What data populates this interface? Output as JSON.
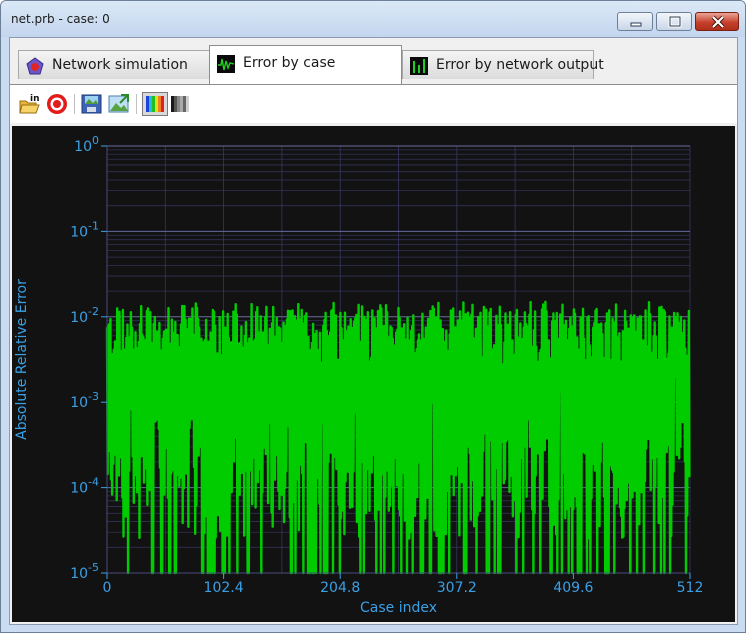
{
  "window": {
    "title": "net.prb - case: 0"
  },
  "tabs": [
    {
      "label": "Network simulation",
      "icon": "network-simulation-icon",
      "active": false
    },
    {
      "label": "Error by case",
      "icon": "error-by-case-icon",
      "active": true
    },
    {
      "label": "Error by network output",
      "icon": "error-by-output-icon",
      "active": false
    }
  ],
  "toolbar": {
    "buttons": [
      "open-input-icon",
      "target-icon",
      "save-image-icon",
      "export-image-icon",
      "color-palette-icon",
      "grayscale-palette-icon"
    ]
  },
  "colors": {
    "plot_background": "#121212",
    "series": "#00cc00",
    "axis_text": "#3aa0e6",
    "grid": "#3c3c6e"
  },
  "chart_data": {
    "type": "bar",
    "title": "",
    "xlabel": "Case index",
    "ylabel": "Absolute Relative Error",
    "yscale": "log",
    "xlim": [
      0,
      512
    ],
    "ylim": [
      1e-05,
      1
    ],
    "x_ticks": [
      "0",
      "102.4",
      "204.8",
      "307.2",
      "409.6",
      "512"
    ],
    "y_ticks": [
      {
        "base": "10",
        "exp": "0"
      },
      {
        "base": "10",
        "exp": "-1"
      },
      {
        "base": "10",
        "exp": "-2"
      },
      {
        "base": "10",
        "exp": "-3"
      },
      {
        "base": "10",
        "exp": "-4"
      },
      {
        "base": "10",
        "exp": "-5"
      }
    ],
    "grid": true,
    "series": [
      {
        "n_cases": 512,
        "typical_max": 0.015,
        "typical_min": 1e-05,
        "typical_band_upper": 0.005,
        "typical_band_lower": 0.0001
      }
    ]
  }
}
